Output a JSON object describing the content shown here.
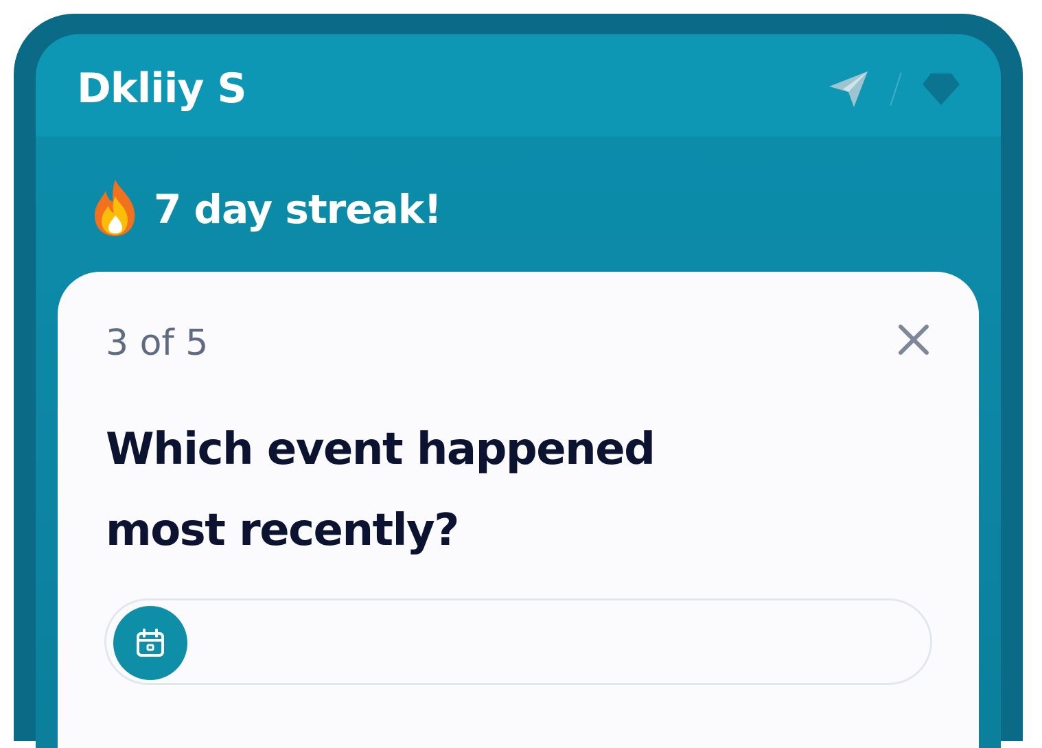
{
  "app": {
    "title": "Dkliiy S"
  },
  "header": {
    "icons": [
      "send-icon",
      "gem-icon"
    ]
  },
  "streak": {
    "icon": "fire-icon",
    "text": "7 day streak!"
  },
  "quiz": {
    "progress": "3 of 5",
    "question_line1": "Which event happened",
    "question_line2": "most recently?",
    "options": [
      {
        "icon": "calendar-icon",
        "label": ""
      }
    ]
  },
  "colors": {
    "frame": "#0b6a85",
    "header": "#0d97b5",
    "accent": "#0e8ea7",
    "card": "#fbfbfd",
    "text_dark": "#0b1330",
    "text_muted": "#5e6b80"
  }
}
